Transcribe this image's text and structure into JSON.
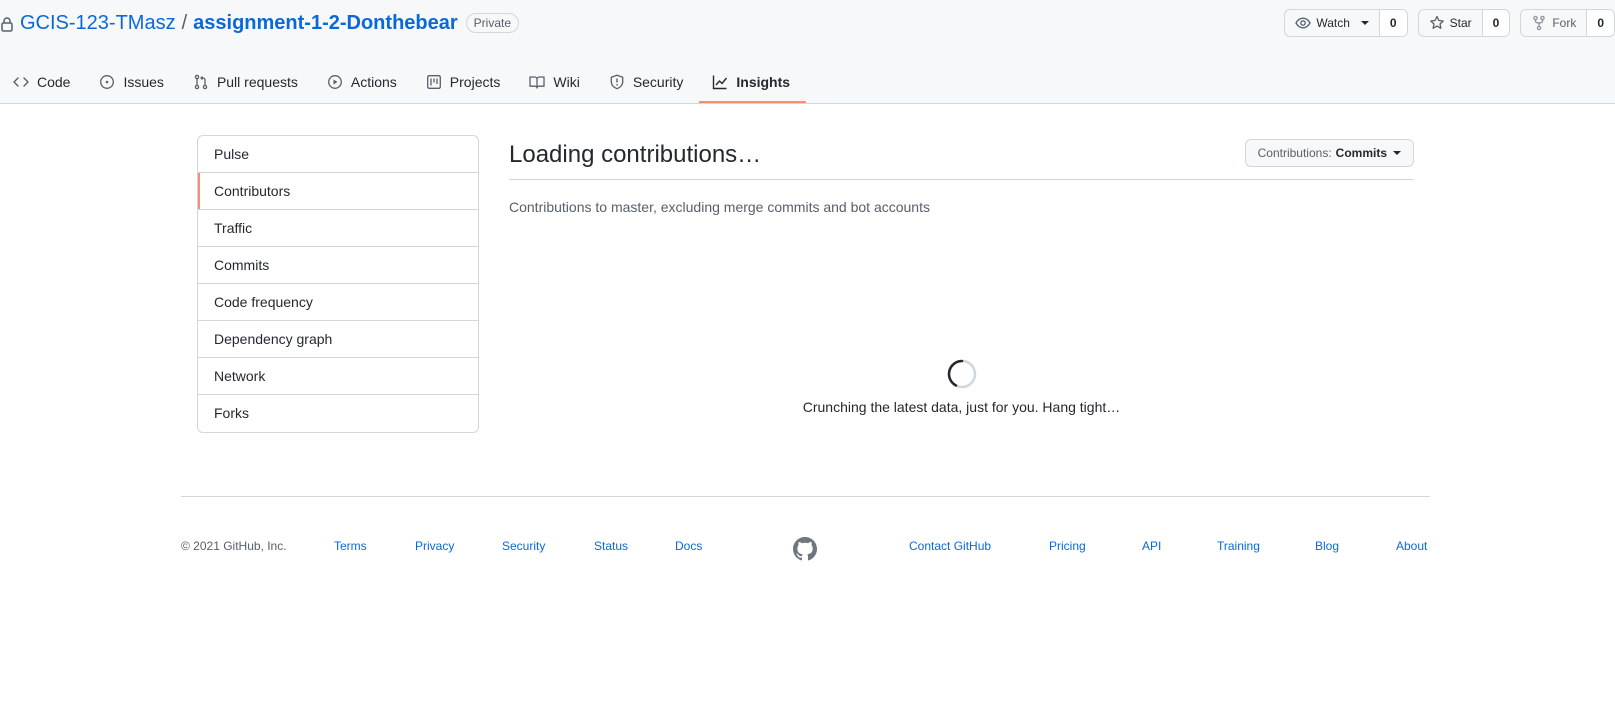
{
  "repo": {
    "owner": "GCIS-123-TMasz",
    "separator": "/",
    "name": "assignment-1-2-Donthebear",
    "visibility": "Private"
  },
  "actions": {
    "watch": {
      "label": "Watch",
      "count": "0"
    },
    "star": {
      "label": "Star",
      "count": "0"
    },
    "fork": {
      "label": "Fork",
      "count": "0"
    }
  },
  "tabs": [
    {
      "label": "Code",
      "icon": "code-icon"
    },
    {
      "label": "Issues",
      "icon": "issue-icon"
    },
    {
      "label": "Pull requests",
      "icon": "pull-request-icon"
    },
    {
      "label": "Actions",
      "icon": "play-icon"
    },
    {
      "label": "Projects",
      "icon": "project-icon"
    },
    {
      "label": "Wiki",
      "icon": "book-icon"
    },
    {
      "label": "Security",
      "icon": "shield-icon"
    },
    {
      "label": "Insights",
      "icon": "graph-icon",
      "selected": true
    }
  ],
  "sidebar": {
    "items": [
      {
        "label": "Pulse"
      },
      {
        "label": "Contributors",
        "selected": true
      },
      {
        "label": "Traffic"
      },
      {
        "label": "Commits"
      },
      {
        "label": "Code frequency"
      },
      {
        "label": "Dependency graph"
      },
      {
        "label": "Network"
      },
      {
        "label": "Forks"
      }
    ]
  },
  "main": {
    "title": "Loading contributions…",
    "select_prefix": "Contributions:",
    "select_value": "Commits",
    "subtitle": "Contributions to master, excluding merge commits and bot accounts",
    "loading_text": "Crunching the latest data, just for you. Hang tight…"
  },
  "footer": {
    "copyright": "© 2021 GitHub, Inc.",
    "left_links": [
      "Terms",
      "Privacy",
      "Security",
      "Status",
      "Docs"
    ],
    "right_links": [
      "Contact GitHub",
      "Pricing",
      "API",
      "Training",
      "Blog",
      "About"
    ]
  },
  "colors": {
    "accent_link": "#0969da",
    "selected_underline": "#fd8c73",
    "border": "#d0d7de",
    "header_bg": "#f6f8fa"
  }
}
